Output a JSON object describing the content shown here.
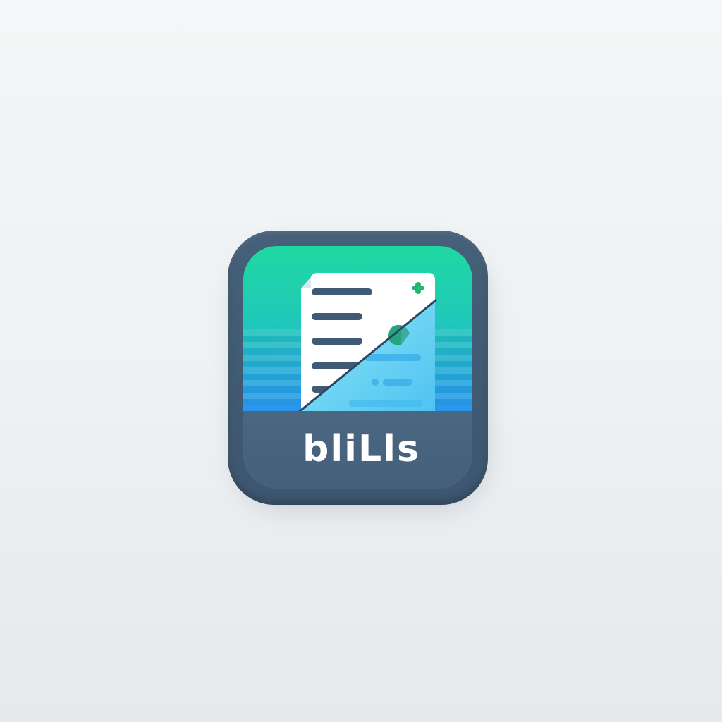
{
  "app_icon": {
    "name": "bliLls",
    "icon": "bill-document-icon",
    "colors": {
      "background": "#f1f3f5",
      "frame": "#425b74",
      "label_band": "#46617b",
      "gradient_top": "#1fd6a3",
      "gradient_bottom": "#2aa2ee",
      "document": "#ffffff",
      "document_lines": "#3f5a75",
      "accent_green": "#22b573"
    }
  }
}
